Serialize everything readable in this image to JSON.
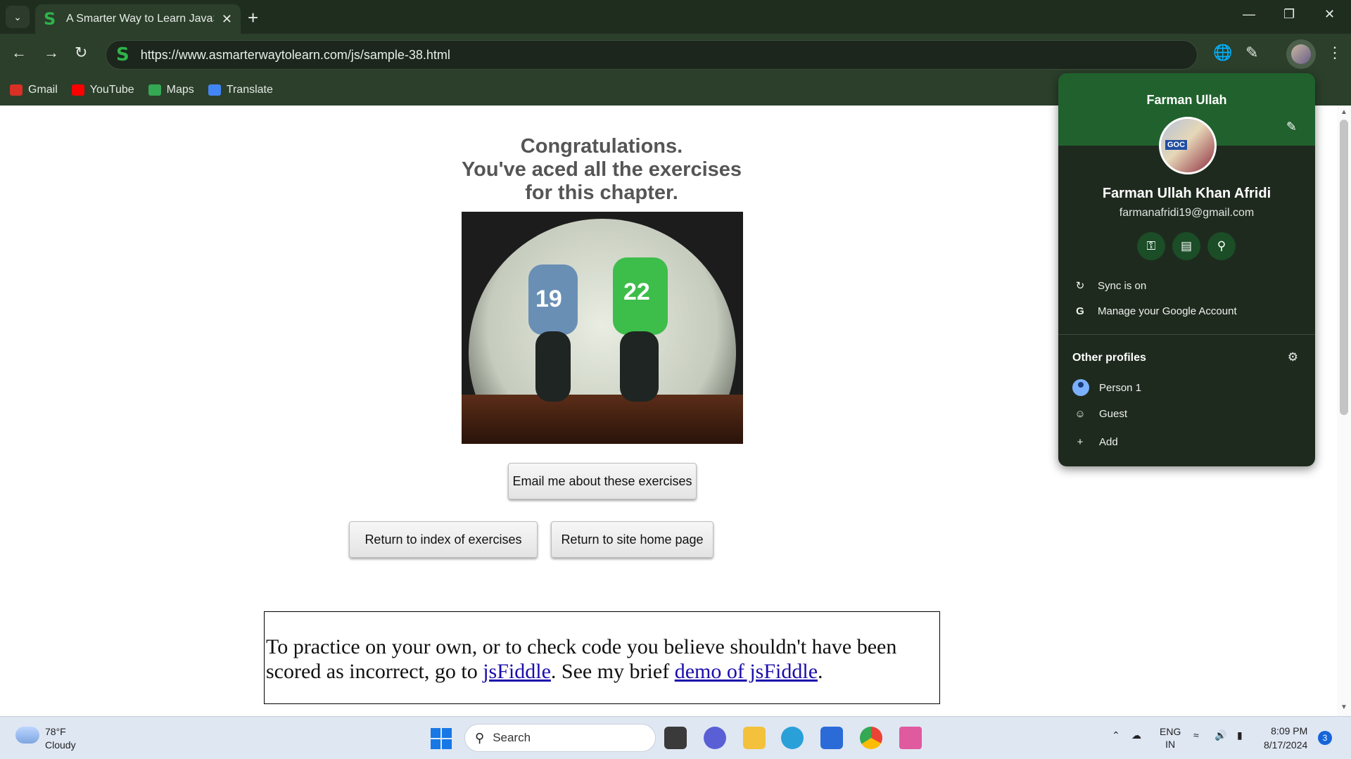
{
  "browser": {
    "tab_title": "A Smarter Way to Learn JavaScr",
    "url": "https://www.asmarterwaytolearn.com/js/sample-38.html",
    "bookmarks": [
      {
        "label": "Gmail",
        "icon": "gmail-icon",
        "color": "#d93025"
      },
      {
        "label": "YouTube",
        "icon": "youtube-icon",
        "color": "#ff0000"
      },
      {
        "label": "Maps",
        "icon": "maps-icon",
        "color": "#34a853"
      },
      {
        "label": "Translate",
        "icon": "translate-icon",
        "color": "#4285f4"
      }
    ]
  },
  "page": {
    "congrats_line1": "Congratulations.",
    "congrats_line2": "You've aced all the exercises",
    "congrats_line3": "for this chapter.",
    "photo_jersey_left": "19",
    "photo_jersey_right": "22",
    "email_button": "Email me about these exercises",
    "index_button": "Return to index of exercises",
    "home_button": "Return to site home page",
    "practice_text_1": "To practice on your own, or to check code you believe shouldn't have been scored as incorrect, go to ",
    "practice_link_1": "jsFiddle",
    "practice_text_2": ". See my brief ",
    "practice_link_2": "demo of jsFiddle",
    "practice_text_3": "."
  },
  "profile": {
    "header_name": "Farman Ullah",
    "avatar_badge": "GOC",
    "full_name": "Farman Ullah Khan Afridi",
    "email": "farmanafridi19@gmail.com",
    "quick_icons": [
      "key-icon",
      "card-icon",
      "location-icon"
    ],
    "sync_label": "Sync is on",
    "manage_label": "Manage your Google Account",
    "other_profiles_label": "Other profiles",
    "profiles": [
      {
        "label": "Person 1"
      },
      {
        "label": "Guest"
      },
      {
        "label": "Add"
      }
    ],
    "accent": "#20612d"
  },
  "taskbar": {
    "temperature": "78°F",
    "weather": "Cloudy",
    "search_placeholder": "Search",
    "lang_top": "ENG",
    "lang_bottom": "IN",
    "time": "8:09 PM",
    "date": "8/17/2024",
    "notification_count": "3"
  }
}
